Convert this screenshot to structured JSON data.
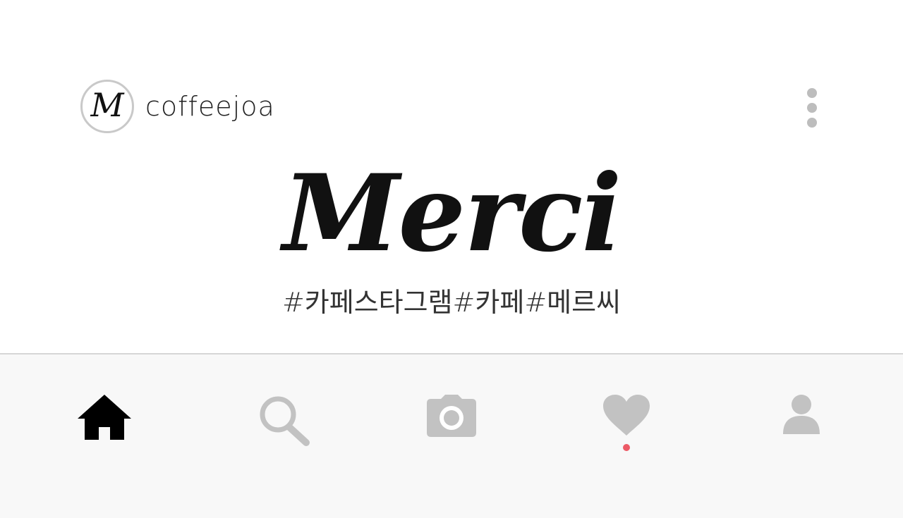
{
  "post": {
    "username": "coffeejoa",
    "avatar_letter": "M",
    "logo_text": "Merci",
    "hashtags": "#카페스타그램#카페#메르씨"
  },
  "nav": {
    "items": [
      {
        "name": "home",
        "icon": "home-icon",
        "active": true
      },
      {
        "name": "search",
        "icon": "search-icon",
        "active": false
      },
      {
        "name": "camera",
        "icon": "camera-icon",
        "active": false
      },
      {
        "name": "activity",
        "icon": "heart-icon",
        "active": false,
        "has_notification": true
      },
      {
        "name": "profile",
        "icon": "person-icon",
        "active": false
      }
    ]
  },
  "colors": {
    "active_icon": "#000000",
    "inactive_icon": "#c2c2c2",
    "notification": "#ec5a66",
    "nav_background": "#f8f8f8"
  }
}
